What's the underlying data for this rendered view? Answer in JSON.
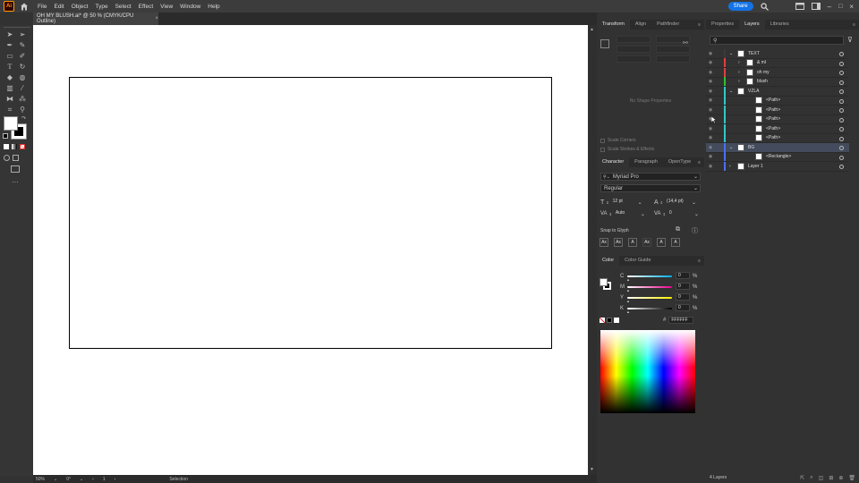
{
  "app": {
    "logo": "Ai"
  },
  "menu": [
    "File",
    "Edit",
    "Object",
    "Type",
    "Select",
    "Effect",
    "View",
    "Window",
    "Help"
  ],
  "share_label": "Share",
  "document_tab": {
    "title": "OH MY BLUSH.ai* @ 50 % (CMYK/CPU Outline)",
    "close": "×"
  },
  "status": {
    "zoom": "50%",
    "rotate": "0°",
    "artboard": "1",
    "tool": "Selection"
  },
  "transform_panel": {
    "tabs": [
      "Transform",
      "Align",
      "Pathfinder"
    ],
    "empty_text": "No Shape Properties",
    "scale_corners": "Scale Corners",
    "scale_strokes": "Scale Strokes & Effects"
  },
  "character_panel": {
    "tabs": [
      "Character",
      "Paragraph",
      "OpenType"
    ],
    "font": "Myriad Pro",
    "style": "Regular",
    "size": "12 pt",
    "leading": "(14,4 pt)",
    "kerning": "Auto",
    "tracking": "0",
    "snap_label": "Snap to Glyph"
  },
  "color_panel": {
    "tabs": [
      "Color",
      "Color Guide"
    ],
    "channels": [
      {
        "label": "C",
        "value": "0",
        "unit": "%",
        "color": "#00aeef"
      },
      {
        "label": "M",
        "value": "0",
        "unit": "%",
        "color": "#ec008c"
      },
      {
        "label": "Y",
        "value": "0",
        "unit": "%",
        "color": "#fff200"
      },
      {
        "label": "K",
        "value": "0",
        "unit": "%",
        "color": "#000000"
      }
    ],
    "hex_prefix": "#",
    "hex": "FFFFFF"
  },
  "layers_panel": {
    "tabs": [
      "Properties",
      "Layers",
      "Libraries"
    ],
    "layers": [
      {
        "name": "TEXT",
        "indent": 0,
        "color": "#3a3a3a",
        "expanded": true,
        "selected": false
      },
      {
        "name": "& ml",
        "indent": 1,
        "color": "#e04040",
        "expanded": false,
        "selected": false
      },
      {
        "name": "oh my",
        "indent": 1,
        "color": "#e04040",
        "expanded": false,
        "selected": false
      },
      {
        "name": "blush",
        "indent": 1,
        "color": "#30c030",
        "expanded": false,
        "selected": false
      },
      {
        "name": "VZLA",
        "indent": 0,
        "color": "#30c8c8",
        "expanded": true,
        "selected": false
      },
      {
        "name": "<Path>",
        "indent": 2,
        "color": "#30c8c8",
        "expanded": null,
        "selected": false
      },
      {
        "name": "<Path>",
        "indent": 2,
        "color": "#30c8c8",
        "expanded": null,
        "selected": false
      },
      {
        "name": "<Path>",
        "indent": 2,
        "color": "#30c8c8",
        "expanded": null,
        "selected": false
      },
      {
        "name": "<Path>",
        "indent": 2,
        "color": "#30c8c8",
        "expanded": null,
        "selected": false
      },
      {
        "name": "<Path>",
        "indent": 2,
        "color": "#30c8c8",
        "expanded": null,
        "selected": false
      },
      {
        "name": "BG",
        "indent": 0,
        "color": "#4a70ff",
        "expanded": true,
        "selected": true
      },
      {
        "name": "<Rectangle>",
        "indent": 2,
        "color": "#4a70ff",
        "expanded": null,
        "selected": false
      },
      {
        "name": "Layer 1",
        "indent": 0,
        "color": "#4a70ff",
        "expanded": false,
        "selected": false
      }
    ],
    "count": "4 Layers"
  }
}
